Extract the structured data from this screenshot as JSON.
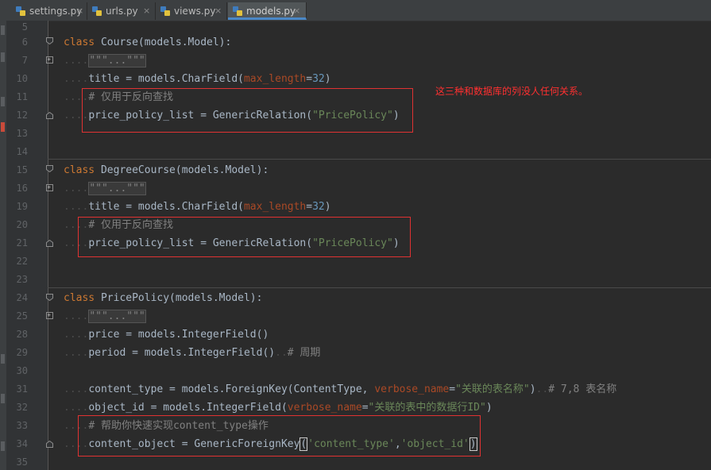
{
  "tabs": [
    {
      "label": "settings.py",
      "active": false
    },
    {
      "label": "urls.py",
      "active": false
    },
    {
      "label": "views.py",
      "active": false
    },
    {
      "label": "models.py",
      "active": true
    }
  ],
  "tab_close_glyph": "×",
  "folded_docstring": "\"\"\"...\"\"\"",
  "annotation": "这三种和数据库的列没人任何关系。",
  "editor": {
    "line_numbers": [
      "5",
      "6",
      "7",
      "10",
      "11",
      "12",
      "13",
      "14",
      "15",
      "16",
      "19",
      "20",
      "21",
      "22",
      "23",
      "24",
      "25",
      "28",
      "29",
      "30",
      "31",
      "32",
      "33",
      "34",
      "35"
    ],
    "course": {
      "class_kw": "class",
      "class_decl": " Course(models.Model):",
      "title_pre": "title = models.CharField(",
      "title_kwarg": "max_length",
      "title_eq": "=",
      "title_num": "32",
      "title_close": ")",
      "comment": "# 仅用于反向查找",
      "rel_pre": "price_policy_list = GenericRelation(",
      "rel_str": "\"PricePolicy\"",
      "rel_close": ")"
    },
    "degree": {
      "class_kw": "class",
      "class_decl": " DegreeCourse(models.Model):",
      "title_pre": "title = models.CharField(",
      "title_kwarg": "max_length",
      "title_eq": "=",
      "title_num": "32",
      "title_close": ")",
      "comment": "# 仅用于反向查找",
      "rel_pre": "price_policy_list = GenericRelation(",
      "rel_str": "\"PricePolicy\"",
      "rel_close": ")"
    },
    "policy": {
      "class_kw": "class",
      "class_decl": " PricePolicy(models.Model):",
      "price": "price = models.IntegerField()",
      "period_pre": "period = models.IntegerField()",
      "period_comment": "# 周期",
      "ct_pre": "content_type = models.ForeignKey(ContentType,",
      "ct_kwarg": "verbose_name",
      "ct_eq": "=",
      "ct_str": "\"关联的表名称\"",
      "ct_close": ")",
      "ct_comment": "# 7,8 表名称",
      "oid_pre": "object_id = models.IntegerField(",
      "oid_kwarg": "verbose_name",
      "oid_eq": "=",
      "oid_str": "\"关联的表中的数据行ID\"",
      "oid_close": ")",
      "help_comment": "# 帮助你快速实现content_type操作",
      "co_pre": "content_object = GenericForeignKey",
      "co_open": "(",
      "co_str1": "'content_type'",
      "co_comma": ",",
      "co_str2": "'object_id'",
      "co_close": ")"
    }
  },
  "colors": {
    "keyword": "#cc7832",
    "string": "#6a8759",
    "number": "#6897bb",
    "kwarg": "#aa4926",
    "comment": "#808080",
    "annotation": "#ff3030",
    "highlight_box": "#e03232"
  }
}
